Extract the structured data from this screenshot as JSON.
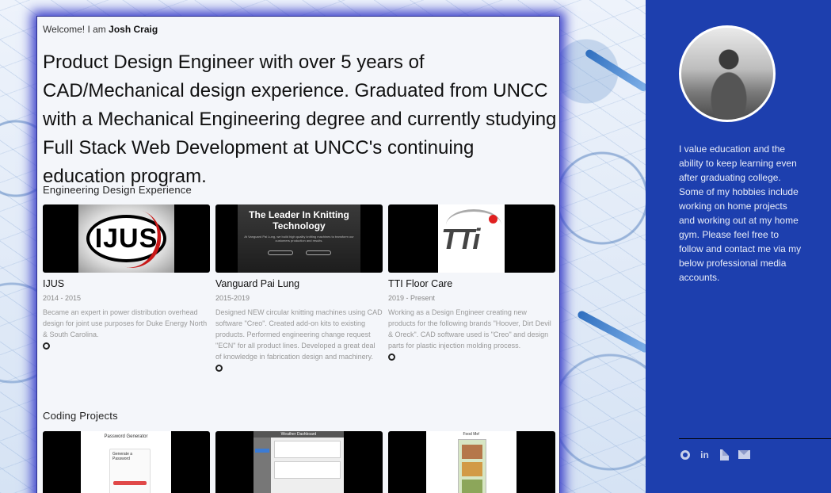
{
  "intro": {
    "welcome_prefix": "Welcome! I am ",
    "name": "Josh Craig",
    "headline": "Product Design Engineer with over 5 years of CAD/Mechanical design experience. Graduated from UNCC with a Mechanical Engineering degree and currently studying Full Stack Web Development at UNCC's continuing education program."
  },
  "experience": {
    "title": "Engineering Design Experience",
    "items": [
      {
        "name": "IJUS",
        "logo_text": "IJUS",
        "dates": "2014 - 2015",
        "description": "Became an expert in power distribution overhead design for joint use purposes for Duke Energy North & South Carolina."
      },
      {
        "name": "Vanguard Pai Lung",
        "logo_title": "The Leader In Knitting Technology",
        "logo_sub": "At Vanguard Pai Lung, we build high quality knitting machines to transform our customers production and results.",
        "dates": "2015-2019",
        "description": "Designed NEW circular knitting machines using CAD software \"Creo\". Created add-on kits to existing products. Performed engineering change request \"ECN\" for all product lines. Developed a great deal of knowledge in fabrication design and machinery."
      },
      {
        "name": "TTI Floor Care",
        "logo_text": "TTi",
        "dates": "2019 - Present",
        "description": "Working as a Design Engineer creating new products for the following brands \"Hoover, Dirt Devil & Oreck\". CAD software used is \"Creo\" and design parts for plastic injection molding process."
      }
    ]
  },
  "coding": {
    "title": "Coding Projects",
    "thumbs": {
      "password": "Password Generator",
      "password_sub": "Generate a Password",
      "weather": "Weather Dashboard",
      "food": "Food Me!"
    }
  },
  "sidebar": {
    "bio": "I value education and the ability to keep learning even after graduating college. Some of my hobbies include working on home projects and working out at my home gym. Please feel free to follow and contact me via my below professional media accounts.",
    "social_icons": [
      "github-icon",
      "linkedin-icon",
      "resume-icon",
      "email-icon"
    ],
    "linkedin_glyph": "in",
    "accent": "#1d3fae"
  }
}
